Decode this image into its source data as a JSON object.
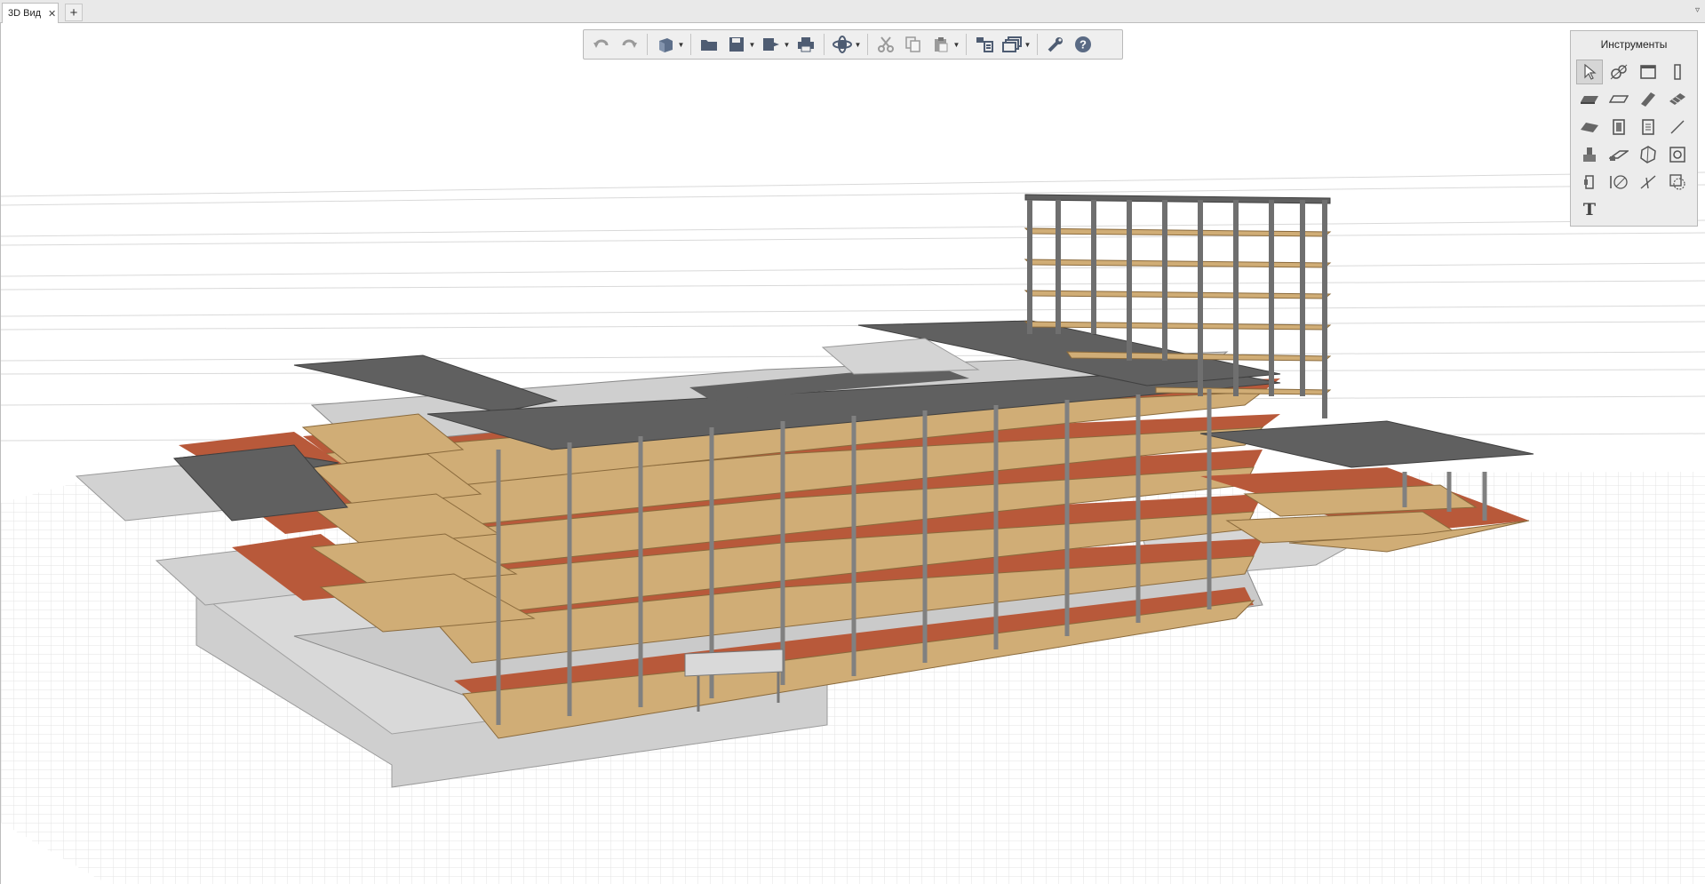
{
  "tabs": [
    {
      "label": "3D Вид",
      "close": "✕"
    }
  ],
  "tab_add": "+",
  "tab_menu": "▿",
  "toolbar": {
    "buttons": [
      "undo-icon",
      "redo-icon",
      "view-cube-icon",
      "open-folder-icon",
      "save-icon",
      "export-icon",
      "print-icon",
      "orbit-icon",
      "cut-icon",
      "copy-icon",
      "paste-icon",
      "layers-icon",
      "views-icon",
      "settings-wrench-icon",
      "help-icon"
    ],
    "help_label": "?"
  },
  "tools_panel": {
    "title": "Инструменты",
    "text_tool": "T",
    "tools": [
      "select-pointer-icon",
      "axis-icon",
      "window-icon",
      "column-icon",
      "slab-icon",
      "floor-plate-icon",
      "beam-icon",
      "stair-icon",
      "roof-icon",
      "door-icon",
      "panel-icon",
      "line-icon",
      "foundation-icon",
      "ramp-icon",
      "polygon-icon",
      "opening-icon",
      "wall-segment-icon",
      "dimension-icon",
      "trim-icon",
      "hatch-icon",
      "text-icon"
    ]
  },
  "colors": {
    "slab_wood": "#d0ad76",
    "slab_rust": "#b8593a",
    "roof_dark": "#606060",
    "concrete_light": "#cfcfcf",
    "column": "#7a7a7a",
    "grid": "#e3e3e3",
    "accent_help": "#5a6a84"
  }
}
